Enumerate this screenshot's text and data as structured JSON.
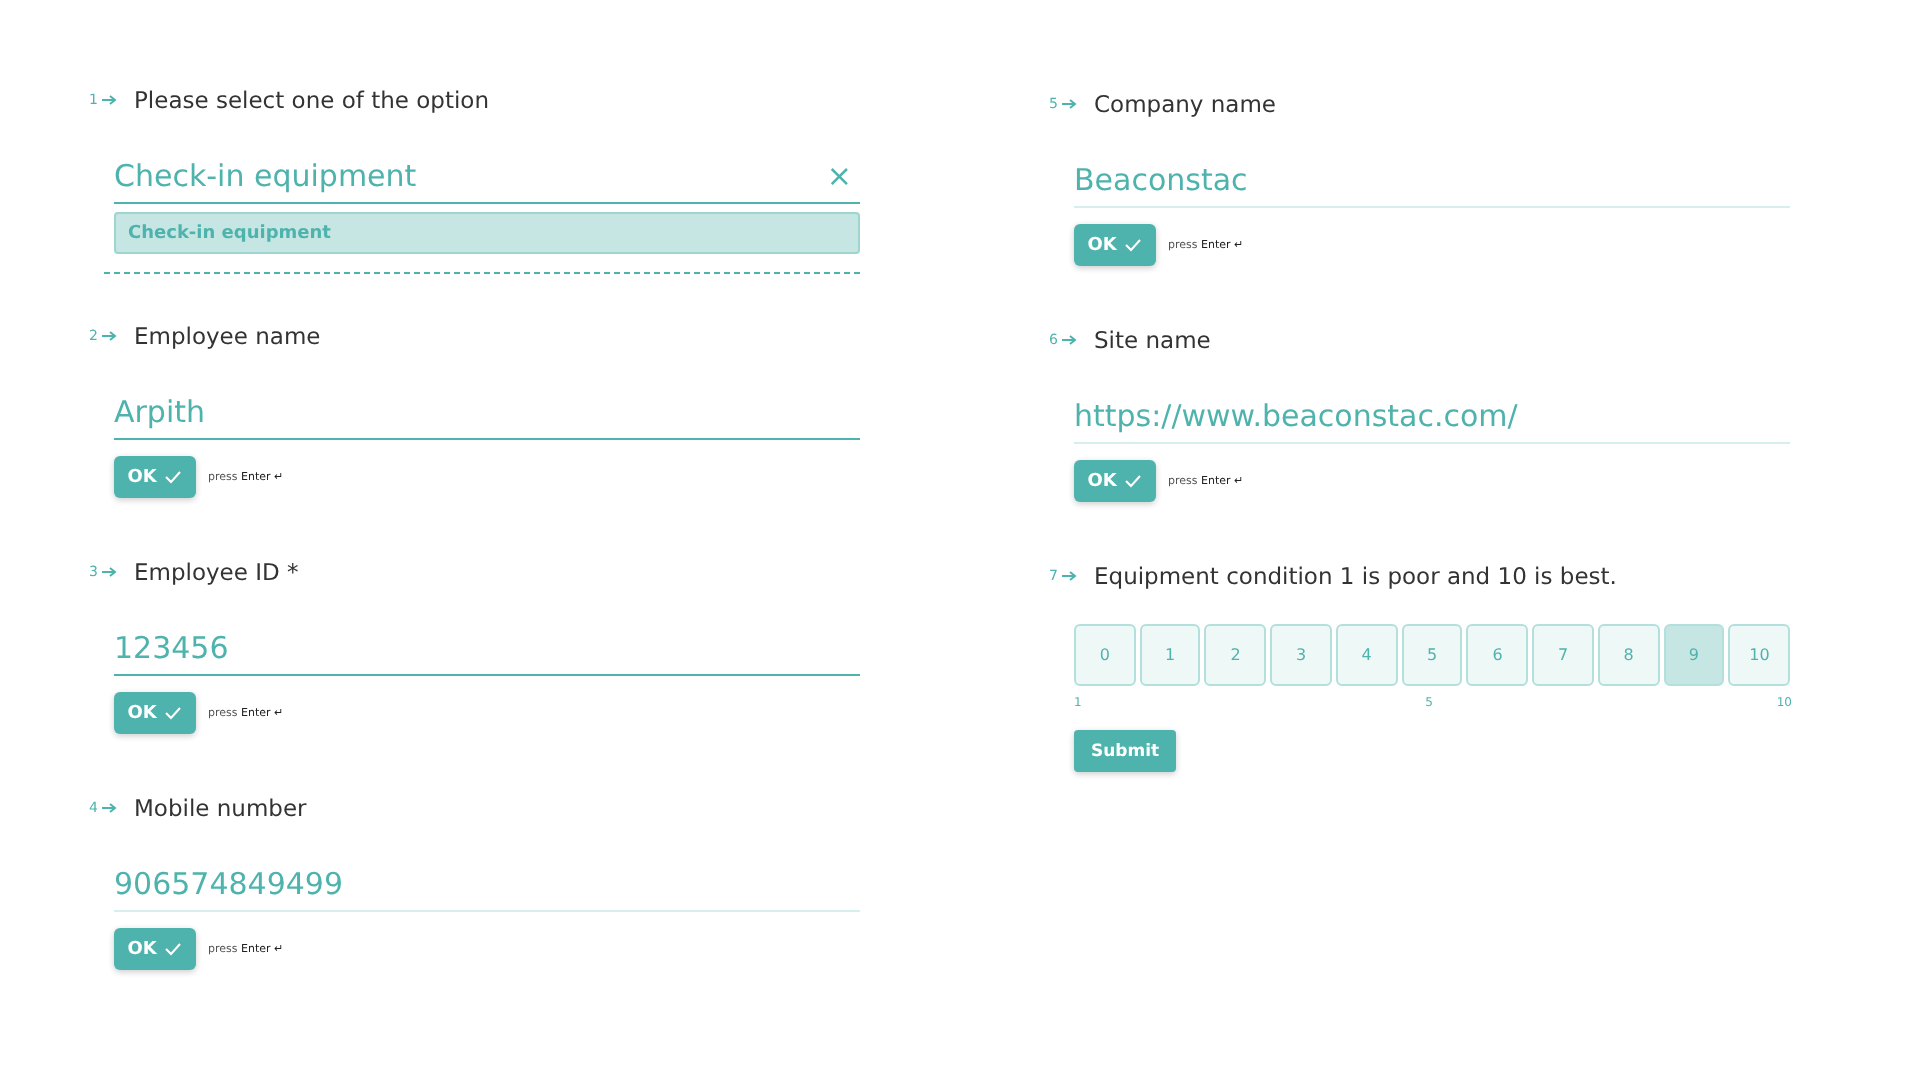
{
  "columns": [
    {
      "questions": [
        {
          "kind": "choice",
          "number": "1",
          "label": "Please select one of the option",
          "value": "Check-in equipment",
          "focused": true,
          "clear": "×",
          "options": [
            {
              "label": "Check-in equipment",
              "selected": true
            }
          ]
        },
        {
          "kind": "text",
          "number": "2",
          "label": "Employee name",
          "value": "Arpith",
          "focused": true,
          "ok": "OK",
          "hint": "press",
          "key": "Enter ↵"
        },
        {
          "kind": "text",
          "number": "3",
          "label": "Employee ID *",
          "value": "123456",
          "focused": true,
          "ok": "OK",
          "hint": "press",
          "key": "Enter ↵"
        },
        {
          "kind": "text",
          "number": "4",
          "label": "Mobile number",
          "value": "906574849499",
          "focused": false,
          "ok": "OK",
          "hint": "press",
          "key": "Enter ↵"
        }
      ]
    },
    {
      "questions": [
        {
          "kind": "text",
          "number": "5",
          "label": "Company name",
          "value": "Beaconstac",
          "focused": false,
          "ok": "OK",
          "hint": "press",
          "key": "Enter ↵"
        },
        {
          "kind": "text",
          "number": "6",
          "label": "Site name",
          "value": "https://www.beaconstac.com/",
          "focused": false,
          "ok": "OK",
          "hint": "press",
          "key": "Enter ↵"
        },
        {
          "kind": "rating",
          "number": "7",
          "label": "Equipment condition 1 is poor and 10 is best.",
          "options": [
            {
              "label": "0",
              "selected": false
            },
            {
              "label": "1",
              "selected": false
            },
            {
              "label": "2",
              "selected": false
            },
            {
              "label": "3",
              "selected": false
            },
            {
              "label": "4",
              "selected": false
            },
            {
              "label": "5",
              "selected": false
            },
            {
              "label": "6",
              "selected": false
            },
            {
              "label": "7",
              "selected": false
            },
            {
              "label": "8",
              "selected": false
            },
            {
              "label": "9",
              "selected": true
            },
            {
              "label": "10",
              "selected": false
            }
          ],
          "scale": [
            "1",
            "5",
            "10"
          ],
          "submit": "Submit"
        }
      ]
    }
  ]
}
